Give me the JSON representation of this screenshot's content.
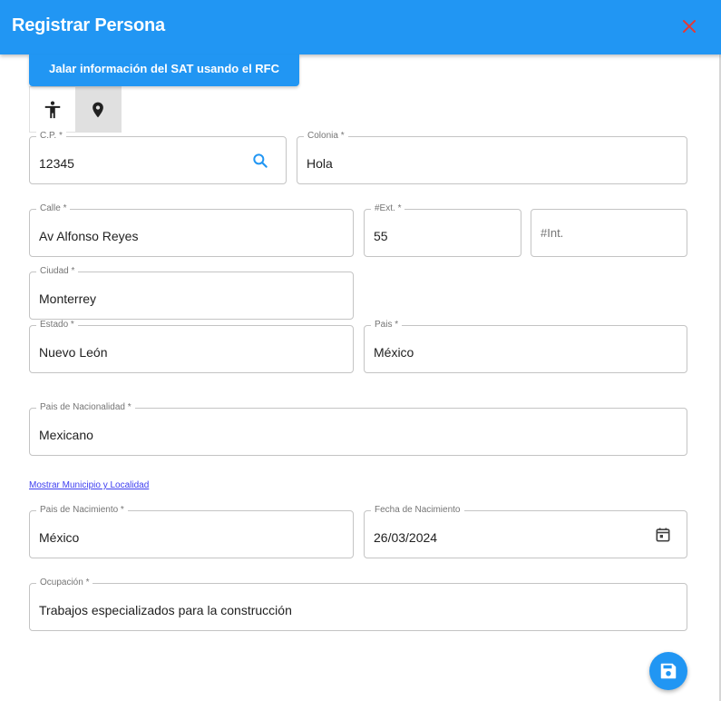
{
  "dialog": {
    "title": "Registrar Persona",
    "close_icon": "close-icon",
    "accent_color": "#2196f3",
    "close_color": "#e53935"
  },
  "sat_button": {
    "label": "Jalar información del SAT usando el RFC"
  },
  "mode_toggle": {
    "items": [
      {
        "icon": "accessibility-person-icon",
        "selected": false
      },
      {
        "icon": "location-pin-icon",
        "selected": true
      }
    ]
  },
  "form": {
    "cp": {
      "label": "C.P. *",
      "value": "12345",
      "icon": "search-icon"
    },
    "colonia": {
      "label": "Colonia *",
      "value": "Hola"
    },
    "calle": {
      "label": "Calle *",
      "value": "Av Alfonso Reyes"
    },
    "ext": {
      "label": "#Ext. *",
      "value": "55"
    },
    "int": {
      "placeholder": "#Int.",
      "value": ""
    },
    "ciudad": {
      "label": "Ciudad *",
      "value": "Monterrey"
    },
    "estado": {
      "label": "Estado *",
      "value": "Nuevo León"
    },
    "pais": {
      "label": "Pais *",
      "value": "México"
    },
    "nacionalidad": {
      "label": "Pais de Nacionalidad *",
      "value": "Mexicano"
    },
    "municipio_link": "Mostrar Municipio y Localidad",
    "pais_nacimiento": {
      "label": "Pais de Nacimiento *",
      "value": "México"
    },
    "fecha_nacimiento": {
      "label": "Fecha de Nacimiento",
      "value": "26/03/2024",
      "icon": "calendar-icon"
    },
    "ocupacion": {
      "label": "Ocupación *",
      "value": "Trabajos especializados para la construcción"
    }
  },
  "save_fab": {
    "icon": "save-floppy-icon"
  }
}
